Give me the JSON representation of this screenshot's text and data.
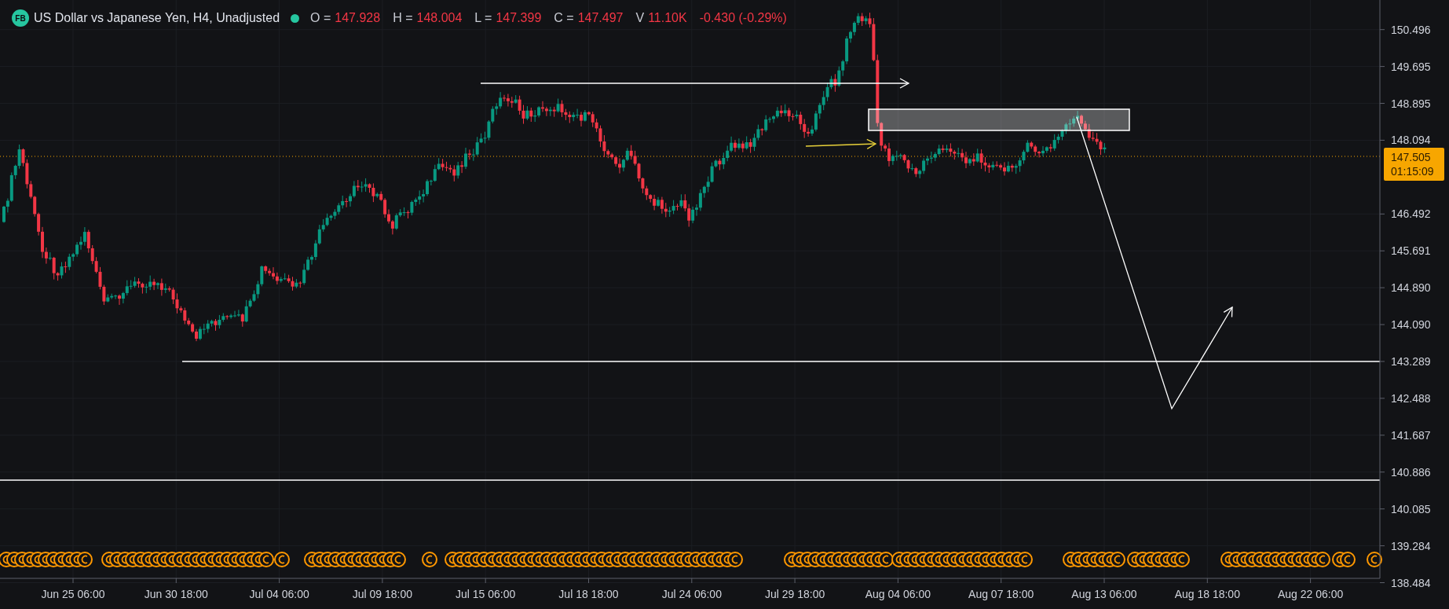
{
  "header": {
    "logo": "FB",
    "title": "US Dollar vs Japanese Yen, H4, Unadjusted",
    "market_open": true,
    "values": [
      {
        "label": "O =",
        "value": "147.928"
      },
      {
        "label": "H =",
        "value": "148.004"
      },
      {
        "label": "L =",
        "value": "147.399"
      },
      {
        "label": "C =",
        "value": "147.497"
      },
      {
        "label": "V",
        "value": "11.10K"
      }
    ],
    "change": "-0.430 (-0.29%)"
  },
  "price_axis": [
    "150.496",
    "149.695",
    "148.895",
    "148.094",
    "146.492",
    "145.691",
    "144.890",
    "144.090",
    "143.289",
    "142.488",
    "141.687",
    "140.886",
    "140.085",
    "139.284",
    "138.484"
  ],
  "current_price": {
    "price": "147.505",
    "countdown": "01:15:09"
  },
  "time_axis": [
    "Jun 25 06:00",
    "Jun 30 18:00",
    "Jul 04 06:00",
    "Jul 09 18:00",
    "Jul 15 06:00",
    "Jul 18 18:00",
    "Jul 24 06:00",
    "Jul 29 18:00",
    "Aug 04 06:00",
    "Aug 07 18:00",
    "Aug 13 06:00",
    "Aug 18 18:00",
    "Aug 22 06:00"
  ]
}
